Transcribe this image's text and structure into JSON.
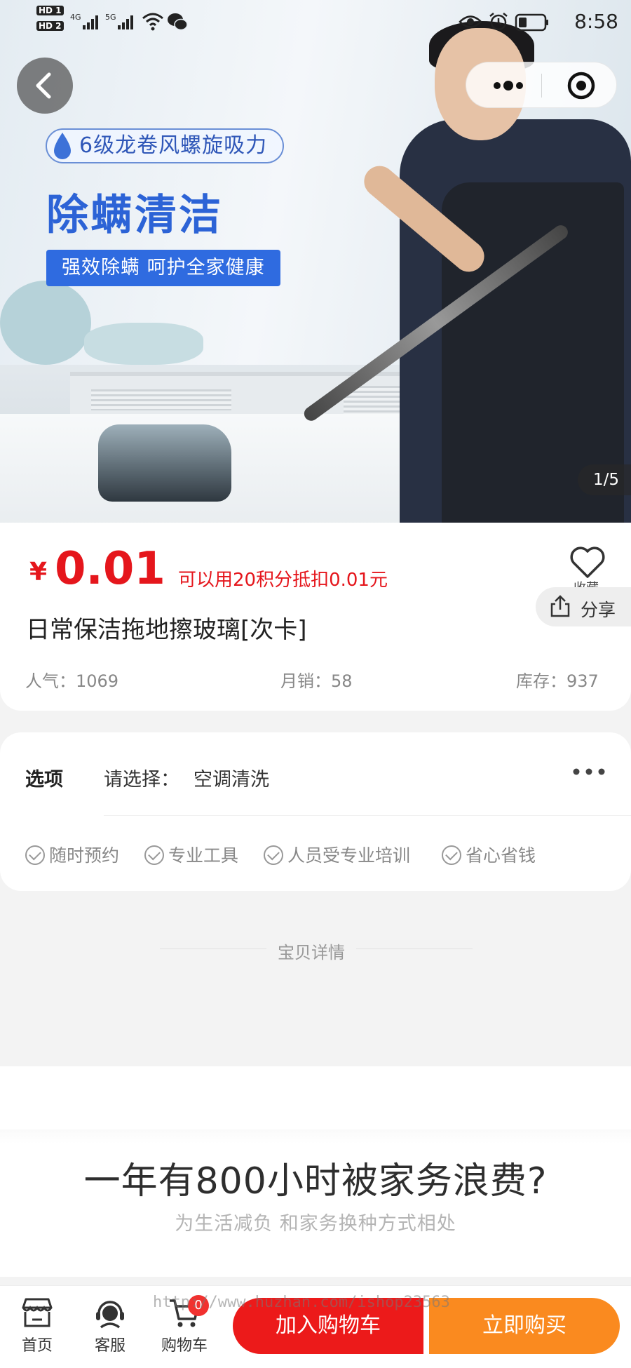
{
  "status_bar": {
    "hd1": "HD 1",
    "hd2": "HD 2",
    "net1": "4G",
    "net2": "5G",
    "time": "8:58"
  },
  "hero": {
    "badge": "6级龙卷风螺旋吸力",
    "title": "除螨清洁",
    "banner": "强效除螨  呵护全家健康",
    "pager": "1/5"
  },
  "product": {
    "currency": "¥",
    "price": "0.01",
    "points_note": "可以用20积分抵扣0.01元",
    "favorite_label": "收藏",
    "share_label": "分享",
    "name": "日常保洁拖地擦玻璃[次卡]",
    "stats": {
      "popularity": "人气：1069",
      "monthly_sales": "月销：58",
      "stock": "库存：937"
    }
  },
  "options": {
    "label": "选项",
    "prefix": "请选择：",
    "value": "空调清洗",
    "features": [
      "随时预约",
      "专业工具",
      "人员受专业培训",
      "省心省钱"
    ]
  },
  "detail": {
    "title": "宝贝详情",
    "slogan": "一年有800小时被家务浪费?",
    "subtitle": "为生活减负 和家务换种方式相处"
  },
  "bottom": {
    "tabs": [
      "首页",
      "客服",
      "购物车"
    ],
    "cart_count": "0",
    "add_to_cart": "加入购物车",
    "buy_now": "立即购买",
    "watermark": "http://www.huzhan.com/ishop23563"
  },
  "colors": {
    "price_red": "#e5161c",
    "cart_button": "#ec1a1a",
    "buy_button": "#fa8a1f",
    "promo_blue": "#2c63d6"
  },
  "icons": [
    "back-icon",
    "more-dots-icon",
    "target-icon",
    "heart-icon",
    "share-icon",
    "check-circle-icon",
    "ellipsis-icon",
    "shop-icon",
    "headset-icon",
    "cart-icon",
    "eye-icon",
    "alarm-icon",
    "battery-icon",
    "wifi-icon",
    "wechat-icon",
    "signal-icon"
  ]
}
